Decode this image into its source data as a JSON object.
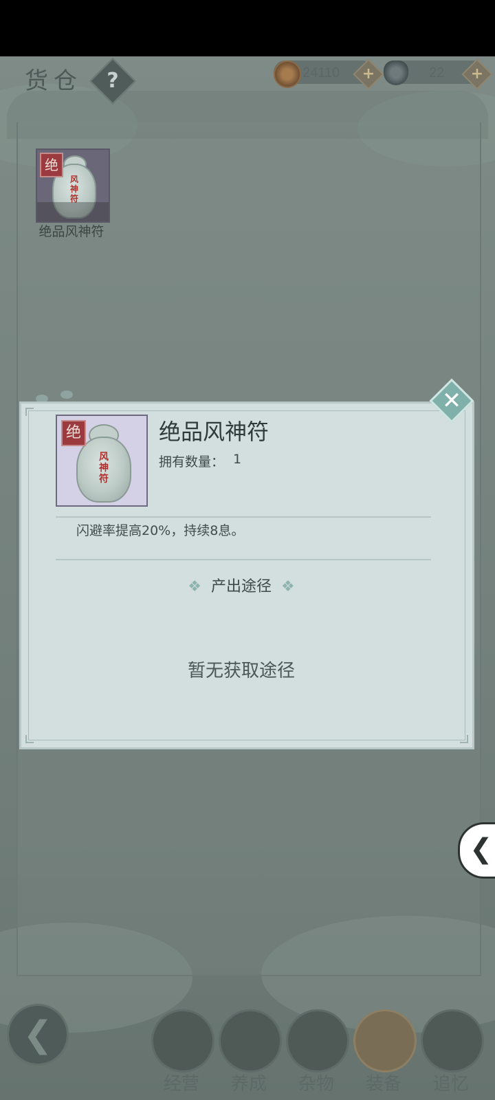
{
  "screen": {
    "title": "货仓",
    "help_label": "?",
    "currencies": [
      {
        "icon": "copper-coin-icon",
        "value": "24110"
      },
      {
        "icon": "silver-ingot-icon",
        "value": "22"
      }
    ],
    "plus_label": "+"
  },
  "inventory": {
    "items": [
      {
        "name": "绝品风神符",
        "grade": "绝"
      }
    ]
  },
  "detail": {
    "name": "绝品风神符",
    "grade": "绝",
    "charm_text": "风神符",
    "qty_label": "拥有数量：",
    "qty_value": "1",
    "description": "闪避率提高20%，持续8息。",
    "source_title": "产出途径",
    "source_empty": "暂无获取途径",
    "close_icon": "close-icon"
  },
  "tabs": [
    {
      "label": "经营",
      "icon": "bowl-icon"
    },
    {
      "label": "养成",
      "icon": "orb-icon"
    },
    {
      "label": "杂物",
      "icon": "bundle-icon"
    },
    {
      "label": "装备",
      "icon": "armor-icon"
    },
    {
      "label": "追忆",
      "icon": "letter-icon"
    }
  ],
  "nav": {
    "back_icon": "back-arrow-icon",
    "side_handle_icon": "chevron-left-icon"
  }
}
